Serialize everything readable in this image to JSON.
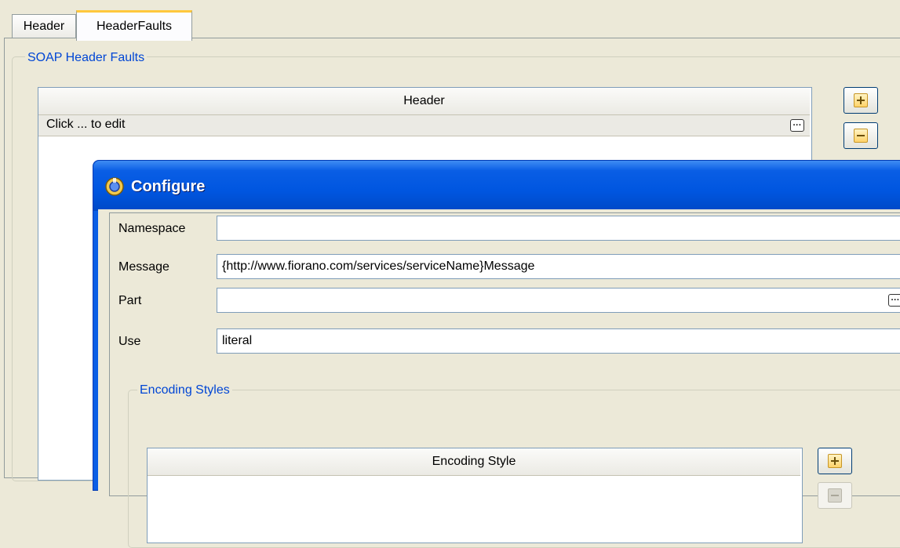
{
  "tabs": [
    {
      "label": "Header",
      "selected": false
    },
    {
      "label": "HeaderFaults",
      "selected": true
    }
  ],
  "soap_group": {
    "title": "SOAP Header Faults",
    "table": {
      "column_header": "Header",
      "rows": [
        {
          "text": "Click ... to edit"
        }
      ]
    },
    "buttons": {
      "add_icon": "plus-icon",
      "remove_icon": "minus-icon"
    }
  },
  "dialog": {
    "title": "Configure",
    "fields": {
      "namespace": {
        "label": "Namespace",
        "value": ""
      },
      "message": {
        "label": "Message",
        "value": "{http://www.fiorano.com/services/serviceName}Message"
      },
      "part": {
        "label": "Part",
        "value": ""
      },
      "use": {
        "label": "Use",
        "value": "literal"
      }
    },
    "encoding_group": {
      "title": "Encoding Styles",
      "column_header": "Encoding Style"
    }
  },
  "colors": {
    "titlebar": "#0a5ee5",
    "group_title": "#0046d5",
    "tab_highlight": "#ffc83c"
  }
}
